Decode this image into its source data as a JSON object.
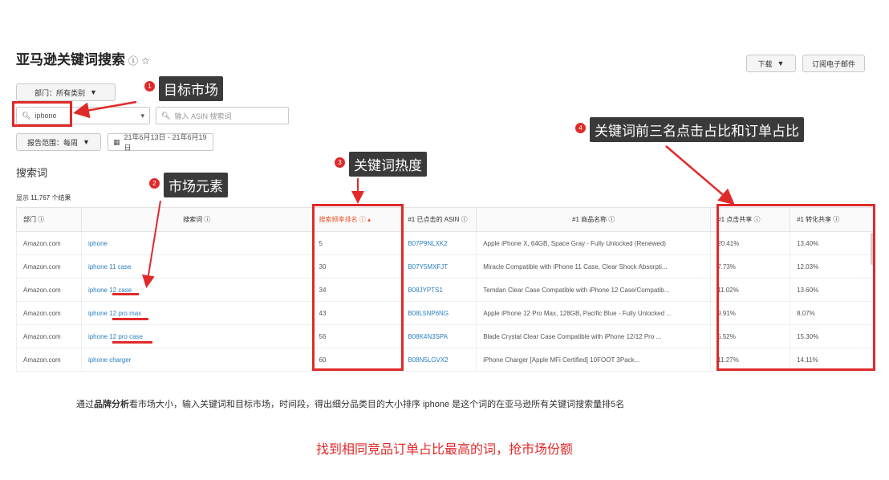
{
  "header": {
    "title": "亚马逊关键词搜索",
    "download_label": "下载",
    "email_button": "订阅电子邮件"
  },
  "filters": {
    "category_label": "部门：所有类别",
    "keyword_value": "iphone",
    "search_placeholder": "输入 ASIN 搜索词",
    "period_label": "报告范围：每周",
    "date_range": "21年6月13日 - 21年6月19日"
  },
  "section": {
    "title": "搜索词",
    "results_count": "显示 11,767 个结果"
  },
  "table": {
    "headers": [
      "部门",
      "搜索词",
      "搜索频率排名",
      "#1 已点击的 ASIN",
      "#1 商品名称",
      "#1 点击共享",
      "#1 转化共享"
    ],
    "rows": [
      [
        "Amazon.com",
        "iphone",
        "5",
        "B07P9NLXK2",
        "Apple iPhone X, 64GB, Space Gray - Fully Unlocked (Renewed)",
        "20.41%",
        "13.40%"
      ],
      [
        "Amazon.com",
        "iphone 11 case",
        "30",
        "B07Y5MXFJT",
        "Miracle Compatible with iPhone 11 Case, Clear Shock Absorpti...",
        "7.73%",
        "12.03%"
      ],
      [
        "Amazon.com",
        "iphone 12 case",
        "34",
        "B08JYPTS1",
        "Temdan Clear Case Compatible with iPhone 12 Case/Compatib...",
        "11.02%",
        "13.60%"
      ],
      [
        "Amazon.com",
        "iphone 12 pro max",
        "43",
        "B08L5NP6NG",
        "Apple iPhone 12 Pro Max, 128GB, Pacific Blue - Fully Unlocked ...",
        "9.91%",
        "8.07%"
      ],
      [
        "Amazon.com",
        "iphone 12 pro case",
        "56",
        "B08K4N3SPA",
        "Blade Crystal Clear Case Compatible with iPhone 12/12 Pro ...",
        "5.52%",
        "15.30%"
      ],
      [
        "Amazon.com",
        "iphone charger",
        "60",
        "B08N5LGVX2",
        "iPhone Charger [Apple MFi Certified] 10FOOT 3Pack...",
        "11.27%",
        "14.11%"
      ]
    ]
  },
  "annotations": {
    "a1": {
      "num": "1",
      "text": "目标市场"
    },
    "a2": {
      "num": "2",
      "text": "市场元素"
    },
    "a3": {
      "num": "3",
      "text": "关键词热度"
    },
    "a4": {
      "num": "4",
      "text": "关键词前三名点击占比和订单占比"
    }
  },
  "caption": {
    "pre": "通过",
    "bold": "品牌分析",
    "post": "看市场大小，输入关键词和目标市场，时间段，得出细分品类目的大小排序 iphone 是这个词的在亚马逊所有关键词搜索量排5名"
  },
  "footer": "找到相同竞品订单占比最高的词，抢市场份额",
  "colors": {
    "accent_red": "#e02a2a",
    "link_blue": "#2b7fbf",
    "annotation_bg": "#3a3a3a"
  }
}
